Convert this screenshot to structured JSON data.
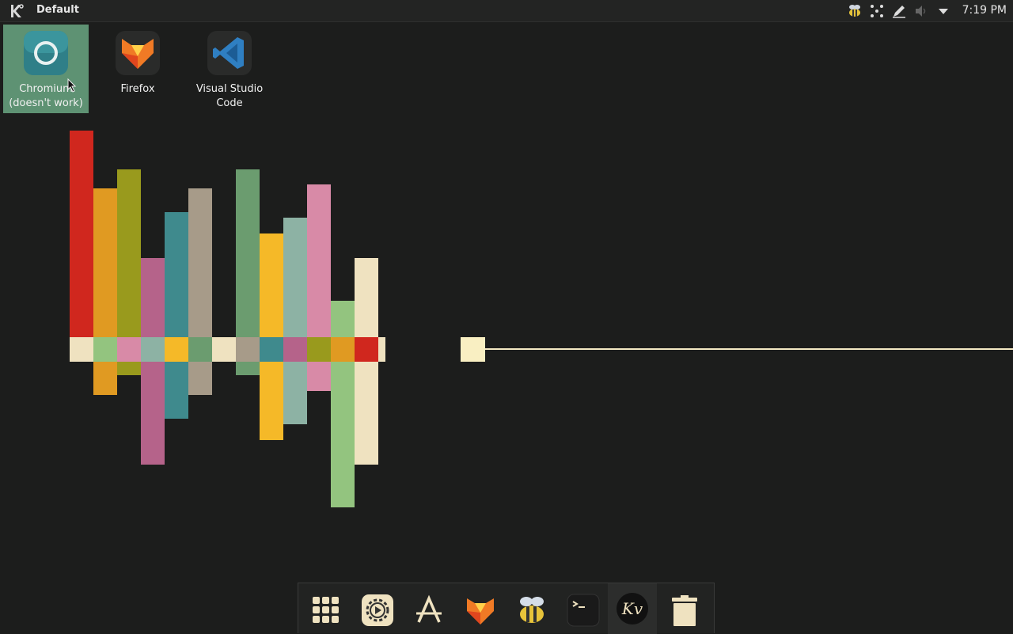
{
  "top_panel": {
    "window_title": "Default",
    "clock": "7:19 PM",
    "tray_icons": [
      "bee-icon",
      "network-icon",
      "pen-icon",
      "volume-muted-icon",
      "dropdown-arrow-icon"
    ]
  },
  "desktop_icons": [
    {
      "label": "Chromium\n(doesn't work)",
      "icon": "chromium-icon",
      "selected": true
    },
    {
      "label": "Firefox",
      "icon": "firefox-icon",
      "selected": false
    },
    {
      "label": "Visual Studio\nCode",
      "icon": "vscode-icon",
      "selected": false
    }
  ],
  "dock_items": [
    {
      "name": "app-grid",
      "icon": "app-grid-icon"
    },
    {
      "name": "settings",
      "icon": "settings-gear-icon"
    },
    {
      "name": "font-viewer",
      "icon": "font-a-icon"
    },
    {
      "name": "firefox",
      "icon": "firefox-icon"
    },
    {
      "name": "bee-app",
      "icon": "bee-icon"
    },
    {
      "name": "terminal",
      "icon": "terminal-icon"
    },
    {
      "name": "kivy",
      "icon": "kivy-icon"
    },
    {
      "name": "trash",
      "icon": "trash-icon"
    }
  ],
  "colors": {
    "background": "#1c1d1c",
    "panel": "#232423",
    "selection": "#5e9273",
    "waveform_line": "#f4e9c4"
  },
  "visualizer": {
    "bars": [
      {
        "up": 261,
        "down": 0,
        "color": "#d0271e"
      },
      {
        "up": 188,
        "down": 42,
        "color": "#e09a22"
      },
      {
        "up": 212,
        "down": 17,
        "color": "#999a1d"
      },
      {
        "up": 100,
        "down": 130,
        "color": "#b5638a"
      },
      {
        "up": 158,
        "down": 72,
        "color": "#3f8a8d"
      },
      {
        "up": 188,
        "down": 42,
        "color": "#a79b89"
      },
      {
        "up": 0,
        "down": 0,
        "color": "#efe2c0"
      },
      {
        "up": 212,
        "down": 17,
        "color": "#6b9c6f"
      },
      {
        "up": 131,
        "down": 99,
        "color": "#f5b928"
      },
      {
        "up": 151,
        "down": 79,
        "color": "#8db2a4"
      },
      {
        "up": 193,
        "down": 37,
        "color": "#d88aa7"
      },
      {
        "up": 46,
        "down": 184,
        "color": "#93c47f"
      },
      {
        "up": 100,
        "down": 130,
        "color": "#efe2c0"
      }
    ],
    "baseline_colors": [
      "#efe2c0",
      "#93c47f",
      "#d88aa7",
      "#8db2a4",
      "#f5b928",
      "#6b9c6f",
      "#efe2c0",
      "#a79b89",
      "#3f8a8d",
      "#b5638a",
      "#999a1d",
      "#e09a22",
      "#d0271e",
      "#efe2c0"
    ]
  }
}
